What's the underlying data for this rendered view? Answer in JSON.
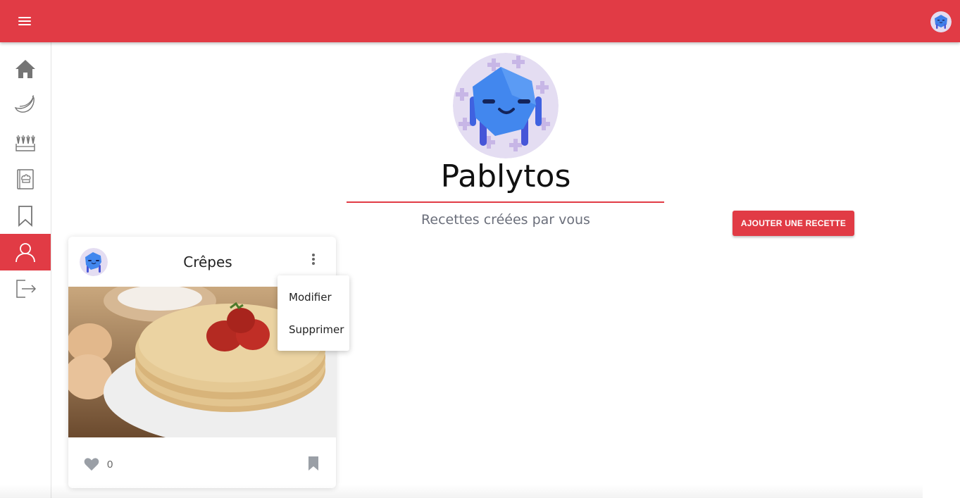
{
  "colors": {
    "brand": "#e13b45",
    "icon_gray": "#757575"
  },
  "topbar": {
    "menu_icon": "hamburger-icon",
    "avatar": "user-avatar-icon"
  },
  "sidebar": {
    "items": [
      {
        "icon": "home-icon",
        "active": false
      },
      {
        "icon": "banana-icon",
        "active": false
      },
      {
        "icon": "vegetables-icon",
        "active": false
      },
      {
        "icon": "recipe-book-icon",
        "active": false
      },
      {
        "icon": "bookmark-icon",
        "active": false
      },
      {
        "icon": "profile-icon",
        "active": true
      },
      {
        "icon": "logout-icon",
        "active": false
      }
    ]
  },
  "profile": {
    "username": "Pablytos",
    "subtitle": "Recettes créées par vous",
    "add_button_label": "AJOUTER UNE RECETTE"
  },
  "recipe_card": {
    "title": "Crêpes",
    "like_count": "0",
    "menu": {
      "items": [
        "Modifier",
        "Supprimer"
      ]
    }
  }
}
